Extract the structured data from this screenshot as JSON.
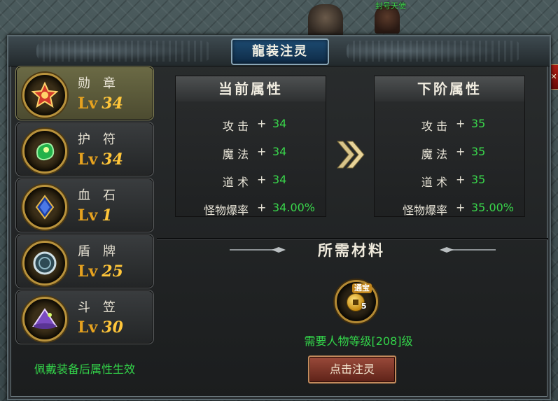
{
  "world": {
    "npc_name": "封号天使"
  },
  "window": {
    "title": "龍装注灵"
  },
  "equipment": [
    {
      "name": "勋章",
      "lv_label": "Lv",
      "level": "34",
      "icon": "medal-icon",
      "selected": true
    },
    {
      "name": "护符",
      "lv_label": "Lv",
      "level": "34",
      "icon": "amulet-icon",
      "selected": false
    },
    {
      "name": "血石",
      "lv_label": "Lv",
      "level": "1",
      "icon": "bloodstone-icon",
      "selected": false
    },
    {
      "name": "盾牌",
      "lv_label": "Lv",
      "level": "25",
      "icon": "shield-icon",
      "selected": false
    },
    {
      "name": "斗笠",
      "lv_label": "Lv",
      "level": "30",
      "icon": "hat-icon",
      "selected": false
    }
  ],
  "hint": "佩戴装备后属性生效",
  "current": {
    "title": "当前属性",
    "attrs": [
      {
        "name": "攻 击",
        "plus": "+",
        "value": "34"
      },
      {
        "name": "魔 法",
        "plus": "+",
        "value": "34"
      },
      {
        "name": "道 术",
        "plus": "+",
        "value": "34"
      },
      {
        "name": "怪物爆率",
        "plus": "+",
        "value": "34.00%"
      }
    ]
  },
  "next": {
    "title": "下阶属性",
    "attrs": [
      {
        "name": "攻 击",
        "plus": "+",
        "value": "35"
      },
      {
        "name": "魔 法",
        "plus": "+",
        "value": "35"
      },
      {
        "name": "道 术",
        "plus": "+",
        "value": "35"
      },
      {
        "name": "怪物爆率",
        "plus": "+",
        "value": "35.00%"
      }
    ]
  },
  "materials": {
    "title": "所需材料",
    "item": {
      "tag": "通宝",
      "count": "5",
      "icon": "coin-icon"
    },
    "requirement": "需要人物等级[208]级"
  },
  "button": {
    "label": "点击注灵"
  },
  "colors": {
    "green_text": "#33d64a",
    "level_gold": "#ffc63a",
    "title_blue": "#1d4b72"
  }
}
